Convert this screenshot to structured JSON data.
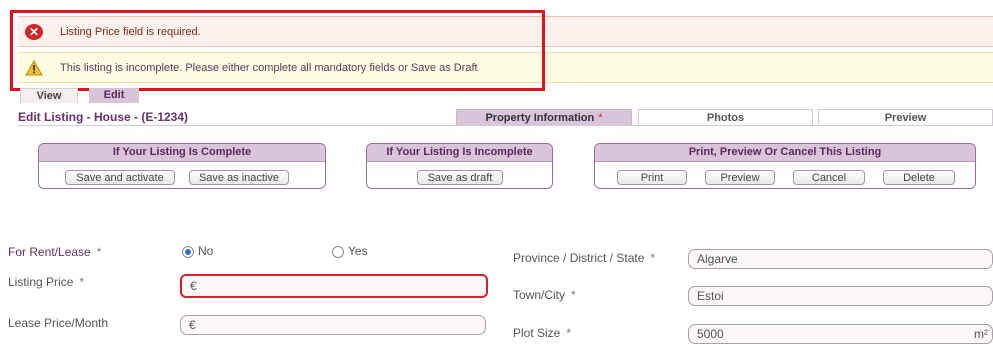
{
  "alerts": {
    "error": "Listing Price field is required.",
    "warning": "This listing is incomplete. Please either complete all mandatory fields or Save as Draft"
  },
  "view_tabs": {
    "view": "View",
    "edit": "Edit"
  },
  "page_title": "Edit Listing - House - (E-1234)",
  "section_tabs": {
    "property_info": "Property Information",
    "property_info_required": "*",
    "photos": "Photos",
    "preview": "Preview"
  },
  "groups": {
    "complete": {
      "title": "If Your Listing Is Complete",
      "save_activate": "Save and activate",
      "save_inactive": "Save as inactive"
    },
    "incomplete": {
      "title": "If Your Listing Is Incomplete",
      "save_draft": "Save as draft"
    },
    "print": {
      "title": "Print, Preview Or Cancel This Listing",
      "print": "Print",
      "preview": "Preview",
      "cancel": "Cancel",
      "delete": "Delete"
    }
  },
  "form": {
    "for_rent": {
      "label": "For Rent/Lease",
      "required": "*",
      "opt_no": "No",
      "opt_yes": "Yes",
      "selected": "No"
    },
    "listing_price": {
      "label": "Listing Price",
      "required": "*",
      "value": "€"
    },
    "lease_price": {
      "label": "Lease Price/Month",
      "value": "€"
    },
    "province": {
      "label": "Province / District / State",
      "required": "*",
      "value": "Algarve"
    },
    "town": {
      "label": "Town/City",
      "required": "*",
      "value": "Estoi"
    },
    "plot_size": {
      "label": "Plot Size",
      "required": "*",
      "value": "5000",
      "unit": "m²"
    }
  },
  "colors": {
    "accent": "#6b2f6b",
    "tab_bg": "#d9c4d9",
    "error": "#d5232a",
    "highlight": "#e3101a"
  }
}
